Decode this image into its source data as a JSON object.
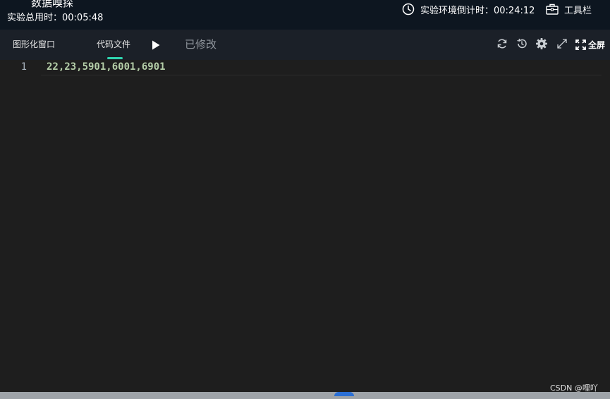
{
  "header": {
    "title": "数据嗅探",
    "elapsed_label": "实验总用时：00:05:48",
    "countdown_label": "实验环境倒计时：00:24:12",
    "toolbar_label": "工具栏"
  },
  "tabs": {
    "graphic_window": "图形化窗口",
    "code_file": "代码文件",
    "status": "已修改",
    "fullscreen": "全屏"
  },
  "editor": {
    "line_number": "1",
    "code": "22,23,5901,6001,6901"
  },
  "watermark": "CSDN @哩吖",
  "colors": {
    "accent": "#2fd5b0",
    "code_text": "#b5cea8",
    "editor_bg": "#1e1e1e",
    "header_bg": "#0d1620"
  },
  "icons": [
    "clock-icon",
    "toolbox-icon",
    "run-icon",
    "refresh-icon",
    "history-icon",
    "settings-icon",
    "expand-icon",
    "fullscreen-icon"
  ]
}
